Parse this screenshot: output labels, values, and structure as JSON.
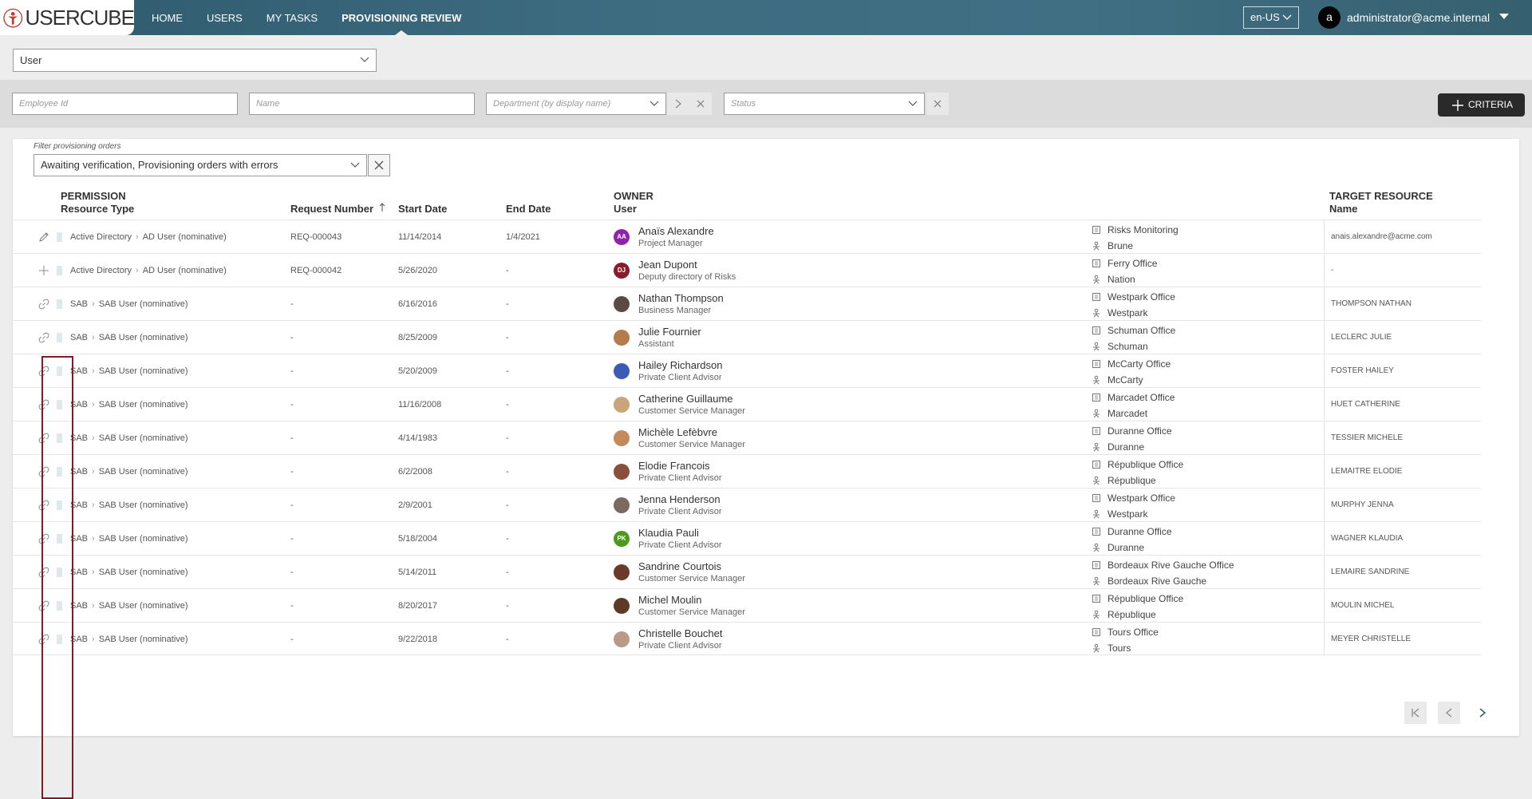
{
  "header": {
    "logo_text": "USERCUBE",
    "nav": [
      "HOME",
      "USERS",
      "MY TASKS",
      "PROVISIONING REVIEW"
    ],
    "active_nav_index": 3,
    "language": "en-US",
    "user_initial": "a",
    "user_email": "administrator@acme.internal"
  },
  "entity_select": {
    "value": "User"
  },
  "filters": {
    "employee_id_placeholder": "Employee Id",
    "name_placeholder": "Name",
    "department_placeholder": "Department (by display name)",
    "status_placeholder": "Status",
    "criteria_label": "CRITERIA"
  },
  "provisioning_filter": {
    "label": "Filter provisioning orders",
    "value": "Awaiting verification, Provisioning orders with errors"
  },
  "columns": {
    "permission_group": "PERMISSION",
    "resource_type": "Resource Type",
    "request_number": "Request Number",
    "start_date": "Start Date",
    "end_date": "End Date",
    "owner_group": "OWNER",
    "owner_user": "User",
    "target_group": "TARGET RESOURCE",
    "target_name": "Name"
  },
  "rows": [
    {
      "action_icon": "pencil-icon",
      "rt_a": "Active Directory",
      "rt_b": "AD User (nominative)",
      "request": "REQ-000043",
      "start": "11/14/2014",
      "end": "1/4/2021",
      "avatar_initials": "AA",
      "avatar_color": "#8e24aa",
      "name": "Anaïs Alexandre",
      "title": "Project Manager",
      "org": "Risks Monitoring",
      "location": "Brune",
      "target": "anais.alexandre@acme.com"
    },
    {
      "action_icon": "plus-icon",
      "rt_a": "Active Directory",
      "rt_b": "AD User (nominative)",
      "request": "REQ-000042",
      "start": "5/26/2020",
      "end": "-",
      "avatar_initials": "DJ",
      "avatar_color": "#8b1a2b",
      "name": "Jean Dupont",
      "title": "Deputy directory of Risks",
      "org": "Ferry Office",
      "location": "Nation",
      "target": "-"
    },
    {
      "action_icon": "link-icon",
      "rt_a": "SAB",
      "rt_b": "SAB User (nominative)",
      "request": "-",
      "start": "6/16/2016",
      "end": "-",
      "avatar_initials": "",
      "avatar_color": "#5a4a42",
      "name": "Nathan Thompson",
      "title": "Business Manager",
      "org": "Westpark Office",
      "location": "Westpark",
      "target": "THOMPSON NATHAN"
    },
    {
      "action_icon": "link-icon",
      "rt_a": "SAB",
      "rt_b": "SAB User (nominative)",
      "request": "-",
      "start": "8/25/2009",
      "end": "-",
      "avatar_initials": "",
      "avatar_color": "#b57b4a",
      "name": "Julie Fournier",
      "title": "Assistant",
      "org": "Schuman Office",
      "location": "Schuman",
      "target": "LECLERC JULIE"
    },
    {
      "action_icon": "link-icon",
      "rt_a": "SAB",
      "rt_b": "SAB User (nominative)",
      "request": "-",
      "start": "5/20/2009",
      "end": "-",
      "avatar_initials": "",
      "avatar_color": "#3b5bb5",
      "name": "Hailey Richardson",
      "title": "Private Client Advisor",
      "org": "McCarty Office",
      "location": "McCarty",
      "target": "FOSTER HAILEY"
    },
    {
      "action_icon": "link-icon",
      "rt_a": "SAB",
      "rt_b": "SAB User (nominative)",
      "request": "-",
      "start": "11/16/2008",
      "end": "-",
      "avatar_initials": "",
      "avatar_color": "#c9a57a",
      "name": "Catherine Guillaume",
      "title": "Customer Service Manager",
      "org": "Marcadet Office",
      "location": "Marcadet",
      "target": "HUET CATHERINE"
    },
    {
      "action_icon": "link-icon",
      "rt_a": "SAB",
      "rt_b": "SAB User (nominative)",
      "request": "-",
      "start": "4/14/1983",
      "end": "-",
      "avatar_initials": "",
      "avatar_color": "#c48a5c",
      "name": "Michèle Lefèbvre",
      "title": "Customer Service Manager",
      "org": "Duranne Office",
      "location": "Duranne",
      "target": "TESSIER MICHELE"
    },
    {
      "action_icon": "link-icon",
      "rt_a": "SAB",
      "rt_b": "SAB User (nominative)",
      "request": "-",
      "start": "6/2/2008",
      "end": "-",
      "avatar_initials": "",
      "avatar_color": "#8a4f3a",
      "name": "Elodie Francois",
      "title": "Private Client Advisor",
      "org": "République Office",
      "location": "République",
      "target": "LEMAITRE ELODIE"
    },
    {
      "action_icon": "link-icon",
      "rt_a": "SAB",
      "rt_b": "SAB User (nominative)",
      "request": "-",
      "start": "2/9/2001",
      "end": "-",
      "avatar_initials": "",
      "avatar_color": "#7a6a62",
      "name": "Jenna Henderson",
      "title": "Private Client Advisor",
      "org": "Westpark Office",
      "location": "Westpark",
      "target": "MURPHY JENNA"
    },
    {
      "action_icon": "link-icon",
      "rt_a": "SAB",
      "rt_b": "SAB User (nominative)",
      "request": "-",
      "start": "5/18/2004",
      "end": "-",
      "avatar_initials": "PK",
      "avatar_color": "#4a9a1e",
      "name": "Klaudia Pauli",
      "title": "Private Client Advisor",
      "org": "Duranne Office",
      "location": "Duranne",
      "target": "WAGNER KLAUDIA"
    },
    {
      "action_icon": "link-icon",
      "rt_a": "SAB",
      "rt_b": "SAB User (nominative)",
      "request": "-",
      "start": "5/14/2011",
      "end": "-",
      "avatar_initials": "",
      "avatar_color": "#6b3a2a",
      "name": "Sandrine Courtois",
      "title": "Customer Service Manager",
      "org": "Bordeaux Rive Gauche Office",
      "location": "Bordeaux Rive Gauche",
      "target": "LEMAIRE SANDRINE"
    },
    {
      "action_icon": "link-icon",
      "rt_a": "SAB",
      "rt_b": "SAB User (nominative)",
      "request": "-",
      "start": "8/20/2017",
      "end": "-",
      "avatar_initials": "",
      "avatar_color": "#5e3a26",
      "name": "Michel Moulin",
      "title": "Customer Service Manager",
      "org": "République Office",
      "location": "République",
      "target": "MOULIN MICHEL"
    },
    {
      "action_icon": "link-icon",
      "rt_a": "SAB",
      "rt_b": "SAB User (nominative)",
      "request": "-",
      "start": "9/22/2018",
      "end": "-",
      "avatar_initials": "",
      "avatar_color": "#b89a86",
      "name": "Christelle Bouchet",
      "title": "Private Client Advisor",
      "org": "Tours Office",
      "location": "Tours",
      "target": "MEYER CHRISTELLE"
    }
  ]
}
